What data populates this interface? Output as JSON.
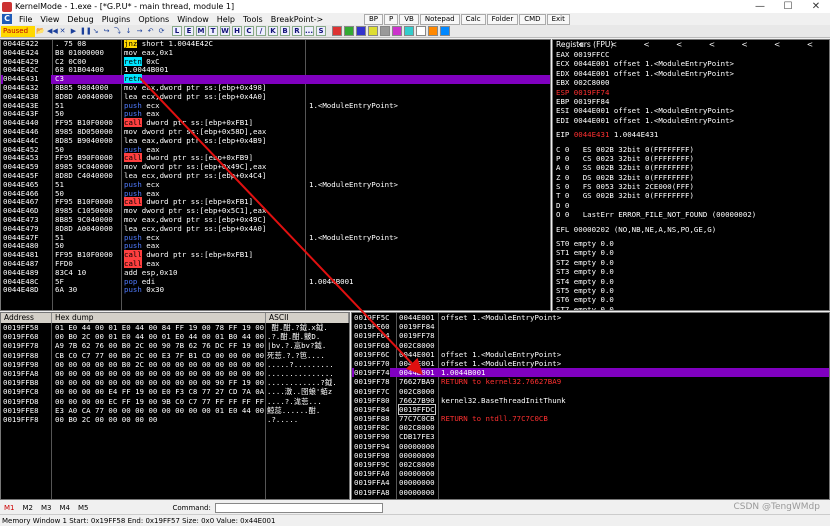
{
  "window": {
    "title": "KernelMode - 1.exe - [*G.P.U* - main thread, module 1]",
    "minimize": "—",
    "maximize": "☐",
    "close": "✕"
  },
  "menu": {
    "logo": "C",
    "items": [
      "File",
      "View",
      "Debug",
      "Plugins",
      "Options",
      "Window",
      "Help",
      "Tools",
      "BreakPoint->"
    ]
  },
  "top_buttons": [
    "BP",
    "P",
    "VB",
    "Notepad",
    "Calc",
    "Folder",
    "CMD",
    "Exit"
  ],
  "toolbar": {
    "status": "Paused",
    "icons": [
      "📂",
      "◀◀",
      "✕",
      "▶",
      "❚❚",
      "↘",
      "↪",
      "⤵",
      "↓",
      "→",
      "↶",
      "⟳"
    ],
    "letters": [
      "L",
      "E",
      "M",
      "T",
      "W",
      "H",
      "C",
      "/",
      "K",
      "B",
      "R",
      "...",
      "S"
    ]
  },
  "disasm": {
    "rows": [
      {
        "addr": "0044E422",
        "hex": ".  75 08",
        "asm": "jnz short 1.0044E42C",
        "kind": "jmp",
        "cmt": ""
      },
      {
        "addr": "0044E424",
        "hex": "B8 01000000",
        "asm": "mov eax,0x1",
        "kind": "norm",
        "cmt": ""
      },
      {
        "addr": "0044E429",
        "hex": "C2 0C00",
        "asm": "retn 0xC",
        "kind": "ret",
        "cmt": ""
      },
      {
        "addr": "0044E42C",
        "hex": "68 01B04400",
        "asm": "     1.0044B001",
        "kind": "norm",
        "cmt": ""
      },
      {
        "addr": "0044E431",
        "hex": "C3",
        "asm": "retn",
        "kind": "ret",
        "cmt": "",
        "cur": true
      },
      {
        "addr": "0044E432",
        "hex": "8B85 9804000",
        "asm": "mov eax,dword ptr ss:[ebp+0x498]",
        "kind": "norm",
        "cmt": ""
      },
      {
        "addr": "0044E438",
        "hex": "8D8D A0040000",
        "asm": "lea ecx,dword ptr ss:[ebp+0x4A0]",
        "kind": "norm",
        "cmt": ""
      },
      {
        "addr": "0044E43E",
        "hex": "51",
        "asm": "push ecx",
        "kind": "push",
        "cmt": "1.<ModuleEntryPoint>"
      },
      {
        "addr": "0044E43F",
        "hex": "50",
        "asm": "push eax",
        "kind": "push",
        "cmt": ""
      },
      {
        "addr": "0044E440",
        "hex": "FF95 B10F0000",
        "asm": "call dword ptr ss:[ebp+0xFB1]",
        "kind": "call",
        "cmt": ""
      },
      {
        "addr": "0044E446",
        "hex": "8985 8D050000",
        "asm": "mov dword ptr ss:[ebp+0x58D],eax",
        "kind": "norm",
        "cmt": ""
      },
      {
        "addr": "0044E44C",
        "hex": "8D85 B9040000",
        "asm": "lea eax,dword ptr ss:[ebp+0x4B9]",
        "kind": "norm",
        "cmt": ""
      },
      {
        "addr": "0044E452",
        "hex": "50",
        "asm": "push eax",
        "kind": "push",
        "cmt": ""
      },
      {
        "addr": "0044E453",
        "hex": "FF95 B90F0000",
        "asm": "call dword ptr ss:[ebp+0xFB9]",
        "kind": "call",
        "cmt": ""
      },
      {
        "addr": "0044E459",
        "hex": "8985 9C040000",
        "asm": "mov dword ptr ss:[ebp+0x49C],eax",
        "kind": "norm",
        "cmt": ""
      },
      {
        "addr": "0044E45F",
        "hex": "8D8D C4040000",
        "asm": "lea ecx,dword ptr ss:[ebp+0x4C4]",
        "kind": "norm",
        "cmt": ""
      },
      {
        "addr": "0044E465",
        "hex": "51",
        "asm": "push ecx",
        "kind": "push",
        "cmt": "1.<ModuleEntryPoint>"
      },
      {
        "addr": "0044E466",
        "hex": "50",
        "asm": "push eax",
        "kind": "push",
        "cmt": ""
      },
      {
        "addr": "0044E467",
        "hex": "FF95 B10F0000",
        "asm": "call dword ptr ss:[ebp+0xFB1]",
        "kind": "call",
        "cmt": ""
      },
      {
        "addr": "0044E46D",
        "hex": "8985 C1050000",
        "asm": "mov dword ptr ss:[ebp+0x5C1],eax",
        "kind": "norm",
        "cmt": ""
      },
      {
        "addr": "0044E473",
        "hex": "8B85 9C040000",
        "asm": "mov eax,dword ptr ss:[ebp+0x49C]",
        "kind": "norm",
        "cmt": ""
      },
      {
        "addr": "0044E479",
        "hex": "8D8D A0040000",
        "asm": "lea ecx,dword ptr ss:[ebp+0x4A0]",
        "kind": "norm",
        "cmt": ""
      },
      {
        "addr": "0044E47F",
        "hex": "51",
        "asm": "push ecx",
        "kind": "push",
        "cmt": "1.<ModuleEntryPoint>"
      },
      {
        "addr": "0044E480",
        "hex": "50",
        "asm": "push eax",
        "kind": "push",
        "cmt": ""
      },
      {
        "addr": "0044E481",
        "hex": "FF95 B10F0000",
        "asm": "call dword ptr ss:[ebp+0xFB1]",
        "kind": "call",
        "cmt": ""
      },
      {
        "addr": "0044E487",
        "hex": "FFD0",
        "asm": "call eax",
        "kind": "call",
        "cmt": ""
      },
      {
        "addr": "0044E489",
        "hex": "83C4 10",
        "asm": "add esp,0x10",
        "kind": "norm",
        "cmt": ""
      },
      {
        "addr": "0044E48C",
        "hex": "5F",
        "asm": "pop edi",
        "kind": "push",
        "cmt": "1.0044B001"
      },
      {
        "addr": "0044E48D",
        "hex": "6A 30",
        "asm": "push 0x30",
        "kind": "push",
        "cmt": ""
      }
    ]
  },
  "registers": {
    "header": "Registers (FPU)",
    "header_arrows": "< < < < < < < <",
    "general": [
      {
        "text": "EAX 0019FFCC"
      },
      {
        "text": "ECX 0044E001 offset 1.<ModuleEntryPoint>"
      },
      {
        "text": "EDX 0044E001 offset 1.<ModuleEntryPoint>"
      },
      {
        "text": "EBX 002C8000"
      },
      {
        "text": "ESP 0019FF74",
        "red": true
      },
      {
        "text": "EBP 0019FF84"
      },
      {
        "text": "ESI 0044E001 offset 1.<ModuleEntryPoint>"
      },
      {
        "text": "EDI 0044E001 offset 1.<ModuleEntryPoint>"
      }
    ],
    "eip": {
      "label": "EIP",
      "value": "0044E431",
      "rest": " 1.0044E431"
    },
    "flags": [
      "C 0   ES 002B 32bit 0(FFFFFFFF)",
      "P 0   CS 0023 32bit 0(FFFFFFFF)",
      "A 0   SS 002B 32bit 0(FFFFFFFF)",
      "Z 0   DS 002B 32bit 0(FFFFFFFF)",
      "S 0   FS 0053 32bit 2CE000(FFF)",
      "T 0   GS 002B 32bit 0(FFFFFFFF)",
      "D 0",
      "O 0   LastErr ERROR_FILE_NOT_FOUND (00000002)"
    ],
    "efl": "EFL 00000202 (NO,NB,NE,A,NS,PO,GE,G)",
    "fpu": [
      "ST0 empty 0.0",
      "ST1 empty 0.0",
      "ST2 empty 0.0",
      "ST3 empty 0.0",
      "ST4 empty 0.0",
      "ST5 empty 0.0",
      "ST6 empty 0.0",
      "ST7 empty 0.0"
    ]
  },
  "dump": {
    "headers": [
      "Address",
      "Hex dump",
      "ASCII"
    ],
    "rows": [
      {
        "addr": "0019FF58",
        "hex": "01 E0 44 00 01 E0 44 00 84 FF 19 00 78 FF 19 00",
        "ascii": " 酣.酣.?鉞.x鉞."
      },
      {
        "addr": "0019FF68",
        "hex": "00 B0 2C 00 01 E0 44 00 01 E0 44 00 01 B0 44 00",
        "ascii": ".?.酣.酣.皽D."
      },
      {
        "addr": "0019FF78",
        "hex": "A9 7B 62 76 00 B0 2C 00 90 7B 62 76 DC FF 19 00",
        "ascii": "|bv.?.悥bv?鉞."
      },
      {
        "addr": "0019FF88",
        "hex": "CB C0 C7 77 00 B0 2C 00 E3 7F B1 CD 00 00 00 00",
        "ascii": "死莣.?.?笆...."
      },
      {
        "addr": "0019FF98",
        "hex": "00 00 00 00 00 B0 2C 00 00 00 00 00 00 00 00 00",
        "ascii": ".....?........."
      },
      {
        "addr": "0019FFA8",
        "hex": "00 00 00 00 00 00 00 00 00 00 00 00 00 00 00 00",
        "ascii": "..............."
      },
      {
        "addr": "0019FFB8",
        "hex": "00 00 00 00 00 00 00 00 00 00 00 00 90 FF 19 00",
        "ascii": "............?鉞."
      },
      {
        "addr": "0019FFC8",
        "hex": "00 00 00 00 E4 FF 19 00 E0 F3 C8 77 27 CD 7A 0A",
        "ascii": "....潡..囹蜋'蛨z"
      },
      {
        "addr": "0019FFD8",
        "hex": "00 00 00 00 EC FF 19 00 9B C0 C7 77 FF FF FF FF",
        "ascii": "....?.浝莣..."
      },
      {
        "addr": "0019FFE8",
        "hex": "E3 A0 CA 77 00 00 00 00 00 00 00 00 01 E0 44 00",
        "ascii": "鯨蕊......酣."
      },
      {
        "addr": "0019FFF8",
        "hex": "00 B0 2C 00 00 00 00 00",
        "ascii": ".?....."
      }
    ]
  },
  "stack": {
    "rows": [
      {
        "addr": "0019FF5C",
        "val": "0044E001",
        "cmt": "offset 1.<ModuleEntryPoint>"
      },
      {
        "addr": "0019FF60",
        "val": "0019FF84",
        "cmt": ""
      },
      {
        "addr": "0019FF64",
        "val": "0019FF78",
        "cmt": ""
      },
      {
        "addr": "0019FF68",
        "val": "002C8000",
        "cmt": ""
      },
      {
        "addr": "0019FF6C",
        "val": "0044E001",
        "cmt": "offset 1.<ModuleEntryPoint>"
      },
      {
        "addr": "0019FF70",
        "val": "0044E001",
        "cmt": "offset 1.<ModuleEntryPoint>"
      },
      {
        "addr": "0019FF74",
        "val": "0044B001",
        "cmt": "1.0044B001",
        "cur": true
      },
      {
        "addr": "0019FF78",
        "val": "76627BA9",
        "cmt": "RETURN to kernel32.76627BA9",
        "red": true
      },
      {
        "addr": "0019FF7C",
        "val": "002C8000",
        "cmt": ""
      },
      {
        "addr": "0019FF80",
        "val": "76627B90",
        "cmt": "kernel32.BaseThreadInitThunk"
      },
      {
        "addr": "0019FF84",
        "val": "0019FFDC",
        "cmt": "",
        "boxed": true
      },
      {
        "addr": "0019FF88",
        "val": "77C7C0CB",
        "cmt": "RETURN to ntdll.77C7C0CB",
        "red": true
      },
      {
        "addr": "0019FF8C",
        "val": "002C8000",
        "cmt": ""
      },
      {
        "addr": "0019FF90",
        "val": "CDB17FE3",
        "cmt": ""
      },
      {
        "addr": "0019FF94",
        "val": "00000000",
        "cmt": ""
      },
      {
        "addr": "0019FF98",
        "val": "00000000",
        "cmt": ""
      },
      {
        "addr": "0019FF9C",
        "val": "002C8000",
        "cmt": ""
      },
      {
        "addr": "0019FFA0",
        "val": "00000000",
        "cmt": ""
      },
      {
        "addr": "0019FFA4",
        "val": "00000000",
        "cmt": ""
      },
      {
        "addr": "0019FFA8",
        "val": "00000000",
        "cmt": ""
      }
    ]
  },
  "bottom": {
    "mem_tabs": [
      "M1",
      "M2",
      "M3",
      "M4",
      "M5"
    ],
    "command_label": "Command:",
    "status": "Memory Window 1  Start: 0x19FF58  End: 0x19FF57  Size: 0x0  Value: 0x44E001",
    "watermark": "CSDN @TengWMdp"
  },
  "colors": {
    "cur_row": "#8000c0",
    "jmp": "#ffd800",
    "call": "#ff3f3f",
    "ret": "#00e5ff",
    "push": "#4f7bff",
    "red_text": "#ff3030",
    "annotation_arrow": "#e01010"
  }
}
